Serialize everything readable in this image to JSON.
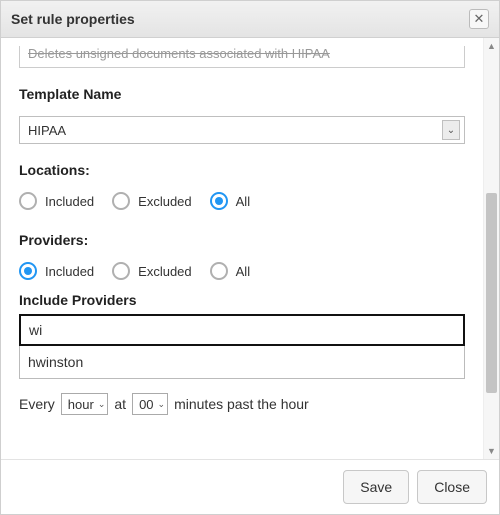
{
  "dialog": {
    "title": "Set rule properties",
    "truncated_text": "Deletes unsigned documents associated with HIPAA"
  },
  "template": {
    "label": "Template Name",
    "value": "HIPAA"
  },
  "locations": {
    "label": "Locations:",
    "options": {
      "included": "Included",
      "excluded": "Excluded",
      "all": "All"
    },
    "selected": "all"
  },
  "providers": {
    "label": "Providers:",
    "options": {
      "included": "Included",
      "excluded": "Excluded",
      "all": "All"
    },
    "selected": "included",
    "include_label": "Include Providers",
    "search_value": "wi",
    "suggestion": "hwinston"
  },
  "schedule": {
    "every_label": "Every",
    "unit": "hour",
    "at_label": "at",
    "minute": "00",
    "suffix": "minutes past the hour"
  },
  "footer": {
    "save": "Save",
    "close": "Close"
  }
}
